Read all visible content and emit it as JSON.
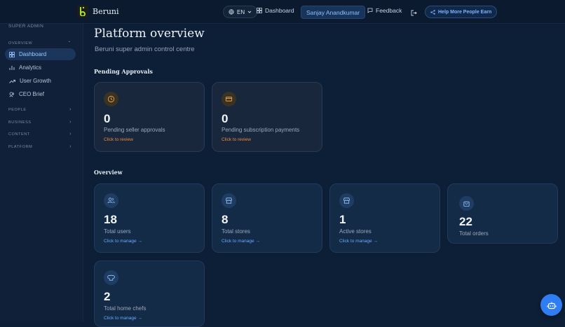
{
  "header": {
    "brand": "Beruni",
    "lang": "EN",
    "dashboard": "Dashboard",
    "user": "Sanjay Anandkumar",
    "feedback": "Feedback",
    "help": "Help More People Earn"
  },
  "sidebar": {
    "role": "SUPER ADMIN",
    "overview_label": "OVERVIEW",
    "items": [
      {
        "label": "Dashboard",
        "icon": "dashboard-icon"
      },
      {
        "label": "Analytics",
        "icon": "bar-chart-icon"
      },
      {
        "label": "User Growth",
        "icon": "trend-icon"
      },
      {
        "label": "CEO Brief",
        "icon": "ceo-icon"
      }
    ],
    "sections": [
      "PEOPLE",
      "BUSINESS",
      "CONTENT",
      "PLATFORM"
    ]
  },
  "main": {
    "title": "Platform overview",
    "subtitle": "Beruni super admin control centre",
    "pending_title": "Pending Approvals",
    "pending": [
      {
        "value": "0",
        "label": "Pending seller approvals",
        "link": "Click to review",
        "icon": "clock-icon"
      },
      {
        "value": "0",
        "label": "Pending subscription payments",
        "link": "Click to review",
        "icon": "card-icon"
      }
    ],
    "overview_title": "Overview",
    "stats": [
      {
        "value": "18",
        "label": "Total users",
        "link": "Click to manage →",
        "icon": "users-icon"
      },
      {
        "value": "8",
        "label": "Total stores",
        "link": "Click to manage →",
        "icon": "store-icon"
      },
      {
        "value": "1",
        "label": "Active stores",
        "link": "Click to manage →",
        "icon": "store-icon"
      },
      {
        "value": "22",
        "label": "Total orders",
        "icon": "bag-icon"
      },
      {
        "value": "2",
        "label": "Total home chefs",
        "link": "Click to manage →",
        "icon": "chef-icon"
      }
    ]
  },
  "colors": {
    "accent": "#2f7df2",
    "amber": "#f08a3c",
    "background": "#0d1f36"
  }
}
